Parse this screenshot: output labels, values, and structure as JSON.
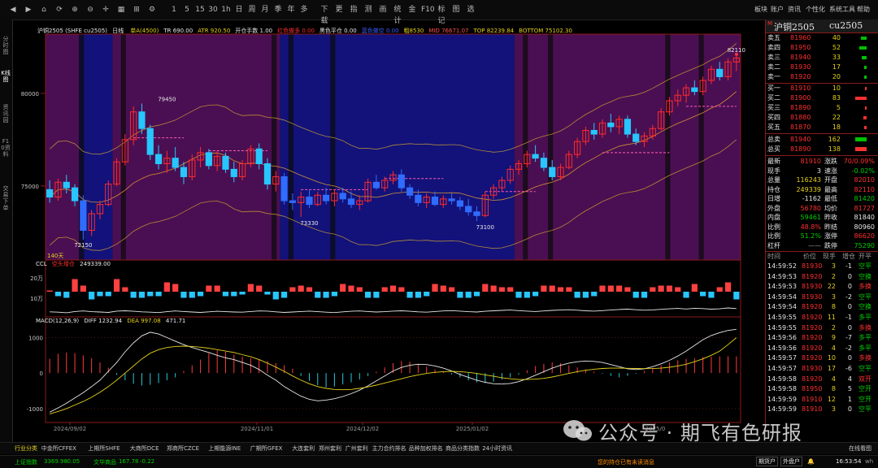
{
  "toolbar": {
    "nav_icons": [
      "back-icon",
      "forward-icon",
      "home-icon",
      "refresh-icon",
      "zoom-in-icon",
      "zoom-out-icon",
      "crosshair-icon",
      "layout-icon",
      "grid-icon",
      "settings-icon"
    ],
    "periods": [
      "1",
      "5",
      "15",
      "30",
      "1h",
      "日",
      "周",
      "月",
      "季",
      "年",
      "多"
    ],
    "tools": [
      "下载",
      "更",
      "指",
      "测",
      "画",
      "统计",
      "金",
      "F10",
      "标记",
      "图",
      "选"
    ],
    "menu": [
      "板块",
      "账户",
      "资讯",
      "个性化",
      "系统工具",
      "帮助"
    ],
    "window_controls": [
      "minimize-icon",
      "maximize-icon",
      "close-icon"
    ]
  },
  "left_tabs": [
    {
      "label": "分时图",
      "active": false
    },
    {
      "label": "K线图",
      "active": true
    },
    {
      "label": "资讯园",
      "active": false
    },
    {
      "label": "F10资料",
      "active": false
    },
    {
      "label": "交易下单",
      "active": false
    }
  ],
  "main_header": {
    "name": "沪铜2505",
    "code": "(SHFE cu2505)",
    "period": "日线",
    "indicators": [
      {
        "text": "单A(4500)",
        "color": "#e6d21a"
      },
      {
        "text": "TR 690.00",
        "color": "#e8e8e8"
      },
      {
        "text": "ATR 920.50",
        "color": "#e6d21a"
      },
      {
        "text": "开仓手数 1.00",
        "color": "#e8e8e8"
      },
      {
        "text": "红色做多 0.00",
        "color": "#ff3030"
      },
      {
        "text": "黑色平仓 0.00",
        "color": "#e8e8e8"
      },
      {
        "text": "蓝色做空 0.00",
        "color": "#3a5cff"
      },
      {
        "text": "粗8530",
        "color": "#e6d21a"
      },
      {
        "text": "MID 76671.07",
        "color": "#ff5050"
      },
      {
        "text": "TOP 82239.84",
        "color": "#e6d21a"
      },
      {
        "text": "BOTTOM 75102.30",
        "color": "#e6d21a"
      }
    ]
  },
  "price_axis": [
    {
      "label": "80000",
      "value": 80000
    },
    {
      "label": "75000",
      "value": 75000
    }
  ],
  "annotations": [
    {
      "label": "82110",
      "value": 82110,
      "bar": 82
    },
    {
      "label": "79450",
      "value": 79450,
      "bar": 14
    },
    {
      "label": "73330",
      "value": 73330,
      "bar": 31
    },
    {
      "label": "73100",
      "value": 73100,
      "bar": 52
    },
    {
      "label": "72150",
      "value": 72150,
      "bar": 4
    }
  ],
  "day_count_label": "140天",
  "ccl_header": {
    "name": "CCL",
    "sub": "空头增仓",
    "value": "249339.00"
  },
  "ccl_axis": [
    "20万",
    "10万"
  ],
  "macd_header": {
    "name": "MACD(12,26,9)",
    "diff": "DIFF 1232.94",
    "dea": "DEA 997.08",
    "macd": "471.71"
  },
  "macd_axis": [
    {
      "label": "1000",
      "value": 1000
    },
    {
      "label": "0",
      "value": 0
    },
    {
      "label": "-1000",
      "value": -1000
    }
  ],
  "date_axis": [
    "2024/09/02",
    "2024/11/01",
    "2024/12/02",
    "2025/01/02",
    "2025/0"
  ],
  "chart_data": {
    "type": "candlestick",
    "ohlc": [
      [
        74800,
        75300,
        74100,
        74400
      ],
      [
        74400,
        75400,
        74200,
        75200
      ],
      [
        75200,
        75600,
        74600,
        74900
      ],
      [
        74900,
        75100,
        73900,
        74200
      ],
      [
        74200,
        74500,
        72100,
        72600
      ],
      [
        72600,
        73700,
        72300,
        73500
      ],
      [
        73500,
        74200,
        73200,
        74000
      ],
      [
        74000,
        75300,
        73900,
        75100
      ],
      [
        75100,
        76500,
        75000,
        76300
      ],
      [
        76300,
        77800,
        76100,
        77500
      ],
      [
        77500,
        79300,
        77200,
        79000
      ],
      [
        79000,
        79450,
        77800,
        78100
      ],
      [
        78100,
        78300,
        76400,
        76700
      ],
      [
        76700,
        77200,
        75900,
        76200
      ],
      [
        76200,
        76900,
        75700,
        76500
      ],
      [
        76500,
        77100,
        75800,
        76000
      ],
      [
        76000,
        76300,
        75100,
        75500
      ],
      [
        75500,
        76700,
        75300,
        76400
      ],
      [
        76400,
        77100,
        76000,
        76800
      ],
      [
        76800,
        77000,
        75900,
        76100
      ],
      [
        76100,
        76900,
        75800,
        76600
      ],
      [
        76600,
        76800,
        75700,
        75900
      ],
      [
        75900,
        76300,
        75200,
        75500
      ],
      [
        75500,
        76400,
        75300,
        76200
      ],
      [
        76200,
        77200,
        76000,
        77000
      ],
      [
        77000,
        77300,
        75900,
        76200
      ],
      [
        76200,
        76500,
        74800,
        75100
      ],
      [
        75100,
        75800,
        74700,
        75500
      ],
      [
        75500,
        75700,
        74000,
        74200
      ],
      [
        74200,
        74600,
        73700,
        74100
      ],
      [
        74100,
        74700,
        73330,
        74400
      ],
      [
        74400,
        74800,
        73800,
        74000
      ],
      [
        74000,
        74700,
        73900,
        74500
      ],
      [
        74500,
        74900,
        74000,
        74200
      ],
      [
        74200,
        74800,
        73900,
        74600
      ],
      [
        74600,
        74900,
        74100,
        74300
      ],
      [
        74300,
        74700,
        73800,
        74000
      ],
      [
        74000,
        74500,
        73700,
        74200
      ],
      [
        74200,
        75400,
        74100,
        75200
      ],
      [
        75200,
        75600,
        74800,
        74900
      ],
      [
        74900,
        75500,
        74700,
        75300
      ],
      [
        75300,
        75800,
        75100,
        75600
      ],
      [
        75600,
        75900,
        74700,
        74900
      ],
      [
        74900,
        75100,
        74300,
        74500
      ],
      [
        74500,
        74800,
        73900,
        74100
      ],
      [
        74100,
        74600,
        73800,
        74400
      ],
      [
        74400,
        74700,
        73900,
        74000
      ],
      [
        74000,
        74500,
        73800,
        74300
      ],
      [
        74300,
        74600,
        74000,
        74200
      ],
      [
        74200,
        74400,
        73700,
        73900
      ],
      [
        73900,
        74300,
        73400,
        73600
      ],
      [
        73600,
        73900,
        73100,
        73400
      ],
      [
        73400,
        74700,
        73300,
        74500
      ],
      [
        74500,
        75100,
        74300,
        74900
      ],
      [
        74900,
        75500,
        74700,
        75300
      ],
      [
        75300,
        76100,
        75100,
        75900
      ],
      [
        75900,
        76400,
        75600,
        76200
      ],
      [
        76200,
        76900,
        76000,
        76700
      ],
      [
        76700,
        77200,
        76300,
        76500
      ],
      [
        76500,
        76800,
        75800,
        76000
      ],
      [
        76000,
        76400,
        75300,
        75500
      ],
      [
        75500,
        76200,
        75300,
        76000
      ],
      [
        76000,
        76900,
        75900,
        76700
      ],
      [
        76700,
        77600,
        76500,
        77400
      ],
      [
        77400,
        78200,
        77200,
        78000
      ],
      [
        78000,
        78400,
        77500,
        77800
      ],
      [
        77800,
        78600,
        77600,
        78400
      ],
      [
        78400,
        78900,
        77900,
        78200
      ],
      [
        78200,
        78800,
        77800,
        78600
      ],
      [
        78600,
        78800,
        77600,
        77800
      ],
      [
        77800,
        78100,
        77200,
        77400
      ],
      [
        77400,
        77900,
        77100,
        77700
      ],
      [
        77700,
        78300,
        77500,
        78100
      ],
      [
        78100,
        79200,
        78000,
        79000
      ],
      [
        79000,
        79800,
        78800,
        79600
      ],
      [
        79600,
        80200,
        79300,
        79900
      ],
      [
        79900,
        80500,
        79500,
        80300
      ],
      [
        80300,
        80700,
        79900,
        80100
      ],
      [
        80100,
        80900,
        79900,
        80700
      ],
      [
        80700,
        81500,
        80500,
        81300
      ],
      [
        81300,
        81700,
        80700,
        80900
      ],
      [
        80900,
        81900,
        80700,
        81700
      ],
      [
        81700,
        82110,
        81200,
        81910
      ]
    ],
    "blocks": [
      {
        "start": 0,
        "end": 4,
        "color": "purple"
      },
      {
        "start": 4,
        "end": 8,
        "color": "blue"
      },
      {
        "start": 8,
        "end": 28,
        "color": "purple"
      },
      {
        "start": 28,
        "end": 56,
        "color": "blue"
      },
      {
        "start": 56,
        "end": 83,
        "color": "purple"
      }
    ],
    "ccl_bars": [
      40,
      38,
      35,
      42,
      45,
      41,
      39,
      37,
      44,
      46,
      43,
      40,
      38,
      36,
      41,
      45,
      42,
      39,
      37,
      40,
      43,
      41,
      39,
      38,
      42,
      45,
      44,
      40,
      37,
      39,
      42,
      44,
      41,
      38,
      36,
      40,
      43,
      45,
      42,
      39,
      41,
      44,
      46,
      43,
      40,
      38,
      42,
      45,
      47,
      44,
      41,
      39,
      43,
      46,
      48,
      50,
      47,
      44,
      42,
      45,
      48,
      50,
      52,
      49,
      46,
      44,
      47,
      50,
      53,
      55,
      52,
      49,
      51,
      54,
      57,
      59,
      56,
      60,
      58,
      55,
      57,
      62,
      58
    ],
    "macd_hist": [
      400,
      540,
      580,
      560,
      500,
      420,
      300,
      150,
      -50,
      -200,
      -300,
      -350,
      -330,
      -280,
      -200,
      -120,
      60,
      220,
      380,
      560,
      640,
      600,
      520,
      460,
      420,
      380,
      340,
      280,
      220,
      120,
      -80,
      -220,
      -340,
      -400,
      -380,
      -320,
      -260,
      -180,
      -80,
      40,
      160,
      280,
      340,
      320,
      260,
      180,
      100,
      40,
      -40,
      -120,
      -200,
      -260,
      -280,
      -240,
      -180,
      -120,
      -40,
      80,
      200,
      260,
      300,
      280,
      220,
      160,
      100,
      40,
      -20,
      -80,
      -120,
      -80,
      -20,
      60,
      140,
      220,
      300,
      360,
      400,
      420,
      450,
      460,
      470,
      472,
      471
    ],
    "macd_diff": [
      -1100,
      -980,
      -850,
      -700,
      -550,
      -380,
      -200,
      50,
      300,
      600,
      850,
      1050,
      1150,
      1100,
      1000,
      900,
      800,
      720,
      650,
      580,
      500,
      430,
      380,
      300,
      220,
      100,
      -60,
      -200,
      -380,
      -520,
      -650,
      -740,
      -780,
      -760,
      -720,
      -660,
      -580,
      -480,
      -360,
      -220,
      -80,
      60,
      160,
      220,
      250,
      240,
      200,
      140,
      60,
      -40,
      -120,
      -200,
      -260,
      -300,
      -310,
      -290,
      -240,
      -160,
      -60,
      40,
      140,
      220,
      280,
      320,
      340,
      330,
      300,
      240,
      180,
      120,
      100,
      120,
      180,
      260,
      360,
      480,
      620,
      780,
      940,
      1060,
      1140,
      1200,
      1232
    ],
    "macd_dea": [
      -1150,
      -1080,
      -1000,
      -900,
      -800,
      -680,
      -540,
      -380,
      -200,
      0,
      200,
      400,
      560,
      660,
      720,
      750,
      760,
      750,
      730,
      700,
      660,
      620,
      580,
      520,
      460,
      380,
      280,
      170,
      50,
      -80,
      -200,
      -300,
      -380,
      -430,
      -460,
      -470,
      -460,
      -430,
      -390,
      -340,
      -280,
      -220,
      -160,
      -100,
      -50,
      -10,
      20,
      40,
      50,
      40,
      20,
      -10,
      -50,
      -90,
      -130,
      -160,
      -180,
      -180,
      -170,
      -150,
      -110,
      -60,
      -10,
      40,
      80,
      110,
      130,
      140,
      140,
      135,
      130,
      125,
      128,
      140,
      165,
      200,
      250,
      320,
      400,
      500,
      620,
      800,
      997
    ]
  },
  "right_panel": {
    "logo": "M",
    "title": "沪铜2505",
    "code": "cu2505",
    "sell": [
      {
        "label": "卖五",
        "price": "81960",
        "vol": "40",
        "bar": 40
      },
      {
        "label": "卖四",
        "price": "81950",
        "vol": "52",
        "bar": 52
      },
      {
        "label": "卖三",
        "price": "81940",
        "vol": "33",
        "bar": 33
      },
      {
        "label": "卖二",
        "price": "81930",
        "vol": "17",
        "bar": 17
      },
      {
        "label": "卖一",
        "price": "81920",
        "vol": "20",
        "bar": 20
      }
    ],
    "buy": [
      {
        "label": "买一",
        "price": "81910",
        "vol": "10",
        "bar": 10
      },
      {
        "label": "买二",
        "price": "81900",
        "vol": "83",
        "bar": 83
      },
      {
        "label": "买三",
        "price": "81890",
        "vol": "5",
        "bar": 5
      },
      {
        "label": "买四",
        "price": "81880",
        "vol": "22",
        "bar": 22
      },
      {
        "label": "买五",
        "price": "81870",
        "vol": "18",
        "bar": 18
      }
    ],
    "totals": [
      {
        "label": "总卖",
        "price": "81940",
        "vol": "162",
        "color": "green"
      },
      {
        "label": "总买",
        "price": "81890",
        "vol": "138",
        "color": "red"
      }
    ],
    "stats": [
      [
        "最新",
        "81910",
        "red",
        "涨跌",
        "70/0.09%",
        "red"
      ],
      [
        "现手",
        "3",
        "white",
        "速涨",
        "-0.02%",
        "green"
      ],
      [
        "总量",
        "116243",
        "yellow",
        "开盘",
        "82010",
        "red"
      ],
      [
        "持仓",
        "249339",
        "yellow",
        "最高",
        "82110",
        "red"
      ],
      [
        "日增",
        "-1162",
        "white",
        "最低",
        "81420",
        "green"
      ],
      [
        "外盘",
        "56780",
        "red",
        "均价",
        "81727",
        "red"
      ],
      [
        "内盘",
        "59461",
        "green",
        "昨收",
        "81840",
        "white"
      ],
      [
        "比例",
        "48.8%",
        "red",
        "昨结",
        "80960",
        "white"
      ],
      [
        "比例",
        "51.2%",
        "green",
        "涨停",
        "86620",
        "red"
      ],
      [
        "杠杆",
        "——",
        "gray",
        "跌停",
        "75290",
        "green"
      ]
    ],
    "tick_header": [
      "时间",
      "价位",
      "现手",
      "增仓",
      "开平"
    ],
    "ticks": [
      [
        "14:59:52",
        "81930",
        "3",
        "-1",
        "空平",
        "green"
      ],
      [
        "14:59:53",
        "81920",
        "2",
        "0",
        "空换",
        "green"
      ],
      [
        "14:59:53",
        "81930",
        "22",
        "0",
        "多换",
        "red"
      ],
      [
        "14:59:54",
        "81930",
        "3",
        "-2",
        "空平",
        "green"
      ],
      [
        "14:59:54",
        "81920",
        "8",
        "0",
        "空换",
        "green"
      ],
      [
        "14:59:55",
        "81920",
        "11",
        "-1",
        "多平",
        "green"
      ],
      [
        "14:59:55",
        "81920",
        "2",
        "0",
        "多换",
        "red"
      ],
      [
        "14:59:56",
        "81920",
        "9",
        "-7",
        "多平",
        "green"
      ],
      [
        "14:59:56",
        "81920",
        "4",
        "-2",
        "多平",
        "green"
      ],
      [
        "14:59:57",
        "81920",
        "10",
        "0",
        "多换",
        "red"
      ],
      [
        "14:59:57",
        "81930",
        "17",
        "-6",
        "空平",
        "green"
      ],
      [
        "14:59:58",
        "81920",
        "4",
        "4",
        "双开",
        "red"
      ],
      [
        "14:59:58",
        "81950",
        "8",
        "5",
        "空开",
        "green"
      ],
      [
        "14:59:59",
        "81910",
        "12",
        "1",
        "空开",
        "green"
      ],
      [
        "14:59:59",
        "81910",
        "3",
        "0",
        "空平",
        "green"
      ]
    ]
  },
  "bottom_tabs": [
    "行业分类",
    "中金所CFFEX",
    "上期所SHFE",
    "大商所DCE",
    "郑商所CZCE",
    "上期能源INE",
    "广期所GFEX",
    "大连套利",
    "郑州套利",
    "广州套利",
    "主力合约排名",
    "品种加权排名",
    "商品分类指数",
    "24小时资讯"
  ],
  "bottom_right_link": "在线看图",
  "status": {
    "sh_index": "上证指数",
    "sh_val": "3369.98",
    "sh_chg": "-0.05",
    "cs_index": "文华商品",
    "cs_val": "167.78",
    "cs_chg": "-0.22",
    "notice": "您的持仓已有未读消息",
    "btn1": "期货户",
    "btn2": "外盘户",
    "clock": "16:53:54",
    "suffix": "wh"
  },
  "watermark": "公众号 · 期飞有色研报"
}
